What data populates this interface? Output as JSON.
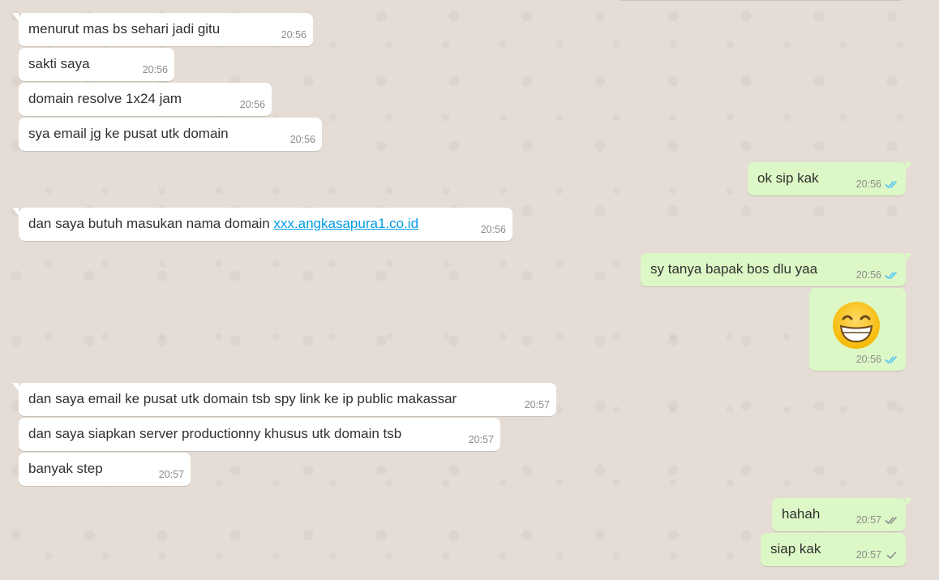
{
  "colors": {
    "wallpaper": "#e5ddd5",
    "incoming_bubble": "#ffffff",
    "outgoing_bubble": "#dcf8c6",
    "read_tick": "#4fc3f7",
    "delivered_tick": "#92a58c",
    "link": "#039be5"
  },
  "messages": [
    {
      "dir": "in",
      "text": "menurut mas bs sehari jadi gitu",
      "time": "20:56"
    },
    {
      "dir": "in",
      "text": "sakti saya",
      "time": "20:56"
    },
    {
      "dir": "in",
      "text": "domain resolve 1x24 jam",
      "time": "20:56"
    },
    {
      "dir": "in",
      "text": "sya email jg ke pusat utk domain",
      "time": "20:56"
    },
    {
      "dir": "out",
      "text": "ok sip kak",
      "time": "20:56",
      "status": "read"
    },
    {
      "dir": "in",
      "text_prefix": "dan saya butuh masukan nama domain ",
      "link": "xxx.angkasapura1.co.id",
      "time": "20:56"
    },
    {
      "dir": "out",
      "text": "sy tanya bapak bos dlu yaa",
      "time": "20:56",
      "status": "read"
    },
    {
      "dir": "out",
      "emoji": "grinning-face-with-smiling-eyes",
      "time": "20:56",
      "status": "read"
    },
    {
      "dir": "in",
      "text": "dan saya email ke pusat utk domain tsb spy link ke ip public makassar",
      "time": "20:57"
    },
    {
      "dir": "in",
      "text": "dan saya siapkan server productionny khusus utk domain tsb",
      "time": "20:57"
    },
    {
      "dir": "in",
      "text": "banyak step",
      "time": "20:57"
    },
    {
      "dir": "out",
      "text": "hahah",
      "time": "20:57",
      "status": "delivered"
    },
    {
      "dir": "out",
      "text": "siap kak",
      "time": "20:57",
      "status": "sent"
    }
  ]
}
